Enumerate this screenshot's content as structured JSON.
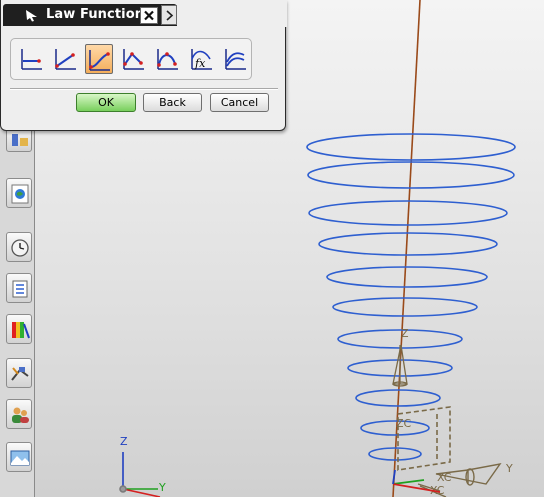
{
  "dialog": {
    "title": "Law Function",
    "law_types": [
      {
        "icon": "constant-law-icon"
      },
      {
        "icon": "linear-law-icon"
      },
      {
        "icon": "cubic-law-icon",
        "selected": true
      },
      {
        "icon": "linear-along-spine-law-icon"
      },
      {
        "icon": "cubic-along-spine-law-icon"
      },
      {
        "icon": "by-equation-law-icon"
      },
      {
        "icon": "by-law-curve-icon"
      }
    ],
    "buttons": {
      "ok": "OK",
      "back": "Back",
      "cancel": "Cancel"
    }
  },
  "resource_bar": {
    "items": [
      "assembly-navigator-icon",
      "web-browser-icon",
      "history-icon",
      "part-navigator-icon",
      "palette-icon",
      "process-tools-icon",
      "roles-icon",
      "system-scenes-icon"
    ]
  },
  "viewport": {
    "labels": {
      "axis_z": "Z",
      "axis_y": "Y",
      "wcs_zc": "ZC",
      "wcs_xc": "XC",
      "datum_xc": "XC",
      "datum_y": "Y",
      "helix_z": "Z"
    },
    "colors": {
      "helix": "#2e5fd0",
      "spine": "#9a4a1a",
      "datum": "#7a6a48",
      "axis_x": "#d42020",
      "axis_y": "#20a020",
      "axis_z": "#2040c0",
      "background": "#e2e2e2"
    }
  }
}
